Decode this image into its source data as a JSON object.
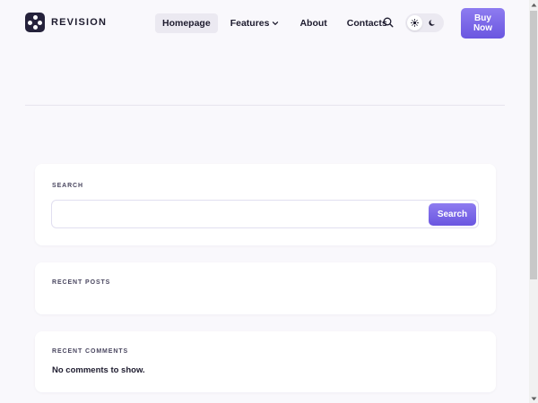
{
  "brand": {
    "name": "REVISION",
    "icon": "logo-icon"
  },
  "nav": {
    "items": [
      {
        "label": "Homepage",
        "active": true
      },
      {
        "label": "Features",
        "has_dropdown": true,
        "dropdown_icon": "chevron-down-icon"
      },
      {
        "label": "About"
      },
      {
        "label": "Contacts"
      }
    ]
  },
  "header": {
    "search_icon": "search-icon",
    "theme_toggle": {
      "light_icon": "sun-icon",
      "dark_icon": "moon-icon",
      "selected": "light"
    },
    "buy_button_label": "Buy Now"
  },
  "sidebar": {
    "search_widget": {
      "title": "SEARCH",
      "input_value": "",
      "button_label": "Search"
    },
    "recent_posts": {
      "title": "RECENT POSTS"
    },
    "recent_comments": {
      "title": "RECENT COMMENTS",
      "empty_message": "No comments to show."
    }
  },
  "colors": {
    "accent": "#7360e8",
    "background": "#f9f8fc",
    "text": "#1d1b2e"
  }
}
